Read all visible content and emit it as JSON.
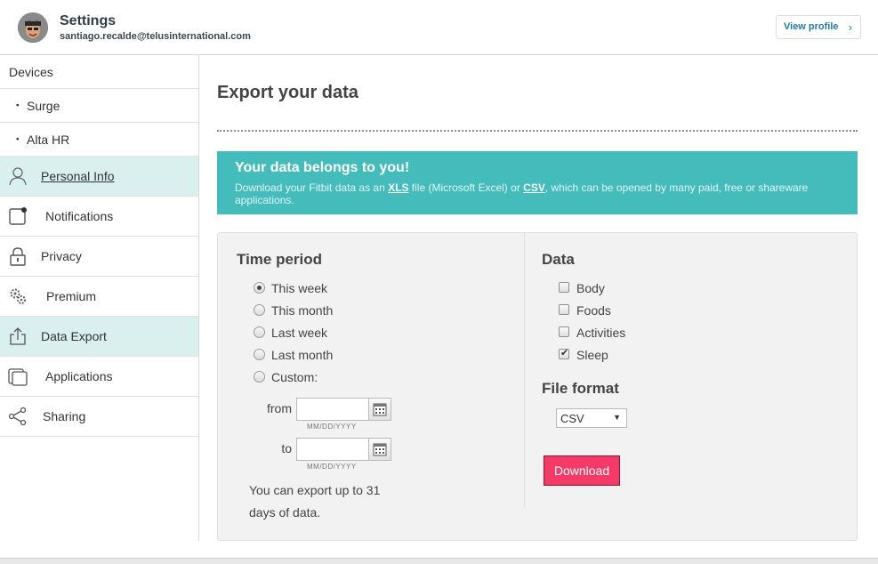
{
  "header": {
    "title": "Settings",
    "email": "santiago.recalde@telusinternational.com",
    "view_profile": "View profile"
  },
  "sidebar": {
    "devices_header": "Devices",
    "devices": [
      "Surge",
      "Alta HR"
    ],
    "items": [
      {
        "label": "Personal Info",
        "icon": "person-icon"
      },
      {
        "label": "Notifications",
        "icon": "notifications-icon"
      },
      {
        "label": "Privacy",
        "icon": "lock-icon"
      },
      {
        "label": "Premium",
        "icon": "gears-icon"
      },
      {
        "label": "Data Export",
        "icon": "export-icon"
      },
      {
        "label": "Applications",
        "icon": "applications-icon"
      },
      {
        "label": "Sharing",
        "icon": "share-icon"
      }
    ]
  },
  "main": {
    "title": "Export your data",
    "banner": {
      "title": "Your data belongs to you!",
      "text_prefix": "Download your Fitbit data as an ",
      "xls": "XLS",
      "text_mid": " file (Microsoft Excel) or ",
      "csv": "CSV",
      "text_suffix": ", which can be opened by many paid, free or shareware applications."
    },
    "time_period": {
      "title": "Time period",
      "options": [
        "This week",
        "This month",
        "Last week",
        "Last month",
        "Custom:"
      ],
      "selected": "This week",
      "from_label": "from",
      "to_label": "to",
      "date_placeholder": "MM/DD/YYYY",
      "note": "You can export up to 31 days of data."
    },
    "data": {
      "title": "Data",
      "options": [
        {
          "label": "Body",
          "checked": false
        },
        {
          "label": "Foods",
          "checked": false
        },
        {
          "label": "Activities",
          "checked": false
        },
        {
          "label": "Sleep",
          "checked": true
        }
      ]
    },
    "file_format": {
      "title": "File format",
      "selected": "CSV"
    },
    "download_label": "Download"
  },
  "colors": {
    "banner": "#44bcbb",
    "active_sidebar": "#daf0ef",
    "download": "#f53a68",
    "link": "#1f7aa8"
  }
}
